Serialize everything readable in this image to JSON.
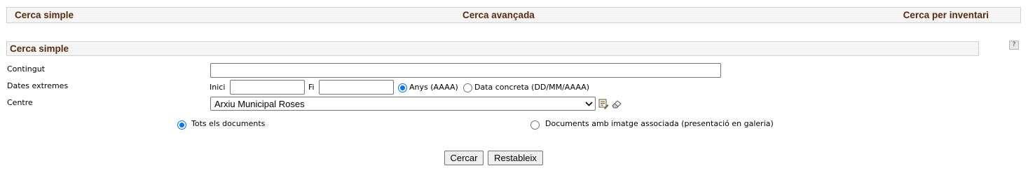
{
  "tabs": [
    {
      "label": "Cerca simple"
    },
    {
      "label": "Cerca avançada"
    },
    {
      "label": "Cerca per inventari"
    }
  ],
  "section": {
    "title": "Cerca simple",
    "help_label": "?"
  },
  "form": {
    "contingut": {
      "label": "Contingut",
      "value": ""
    },
    "dates": {
      "label": "Dates extremes",
      "start_label": "Inici",
      "start_value": "",
      "end_label": "Fi",
      "end_value": "",
      "format_options": [
        {
          "label": "Anys (AAAA)",
          "checked": true
        },
        {
          "label": "Data concreta (DD/MM/AAAA)",
          "checked": false
        }
      ]
    },
    "centre": {
      "label": "Centre",
      "selected": "Arxiu Municipal Roses"
    },
    "scope_options": [
      {
        "label": "Tots els documents",
        "checked": true
      },
      {
        "label": "Documents amb imatge associada (presentació en galeria)",
        "checked": false
      }
    ]
  },
  "buttons": {
    "search": "Cercar",
    "reset": "Restableix"
  },
  "colors": {
    "header_text": "#5b2a0d",
    "radio_accent": "#0075ff"
  },
  "icons": [
    "help-icon",
    "select-list-icon",
    "eraser-icon",
    "chevron-down-icon"
  ]
}
